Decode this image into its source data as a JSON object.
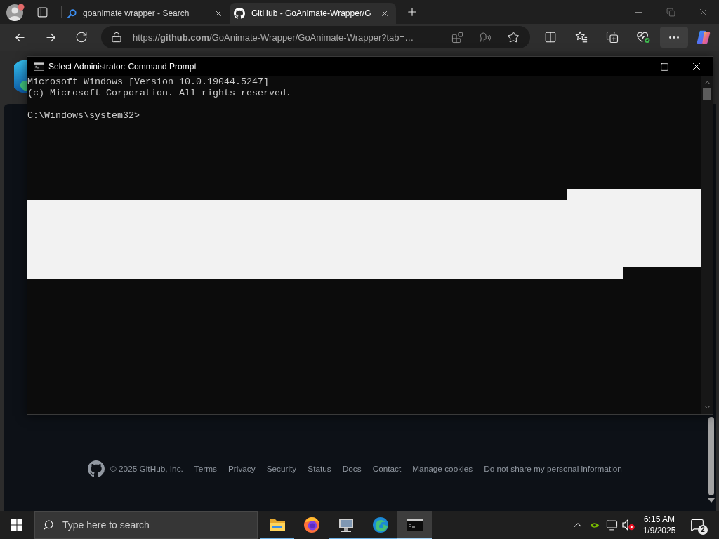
{
  "browser": {
    "tabs": [
      {
        "kind": "search",
        "title": "goanimate wrapper - Search",
        "selected": false
      },
      {
        "kind": "github",
        "title": "GitHub - GoAnimate-Wrapper/G",
        "selected": true
      }
    ],
    "address_bar": {
      "url": "https://**github.com**/GoAnimate-Wrapper/GoAnimate-Wrapper?tab=…"
    },
    "more_button_hovered": true
  },
  "page": {
    "footer": {
      "copyright": "© 2025 GitHub, Inc.",
      "links": [
        "Terms",
        "Privacy",
        "Security",
        "Status",
        "Docs",
        "Contact",
        "Manage cookies",
        "Do not share my personal information"
      ]
    }
  },
  "command_prompt": {
    "title": "Select Administrator: Command Prompt",
    "output_lines": [
      "Microsoft Windows [Version 10.0.19044.5247]",
      "(c) Microsoft Corporation. All rights reserved."
    ],
    "prompt": "C:\\Windows\\system32>",
    "has_selection": true
  },
  "taskbar": {
    "search": {
      "placeholder": "Type here to search"
    },
    "apps": [
      {
        "kind": "explorer",
        "running": true,
        "active": false
      },
      {
        "kind": "firefox",
        "running": false,
        "active": false
      },
      {
        "kind": "system",
        "running": true,
        "active": false
      },
      {
        "kind": "edge",
        "running": true,
        "active": false
      },
      {
        "kind": "terminal",
        "running": true,
        "active": true
      }
    ],
    "tray": {
      "volume_muted": true
    },
    "clock": {
      "time": "6:15 AM",
      "date": "1/9/2025"
    },
    "notification_count": "2"
  }
}
